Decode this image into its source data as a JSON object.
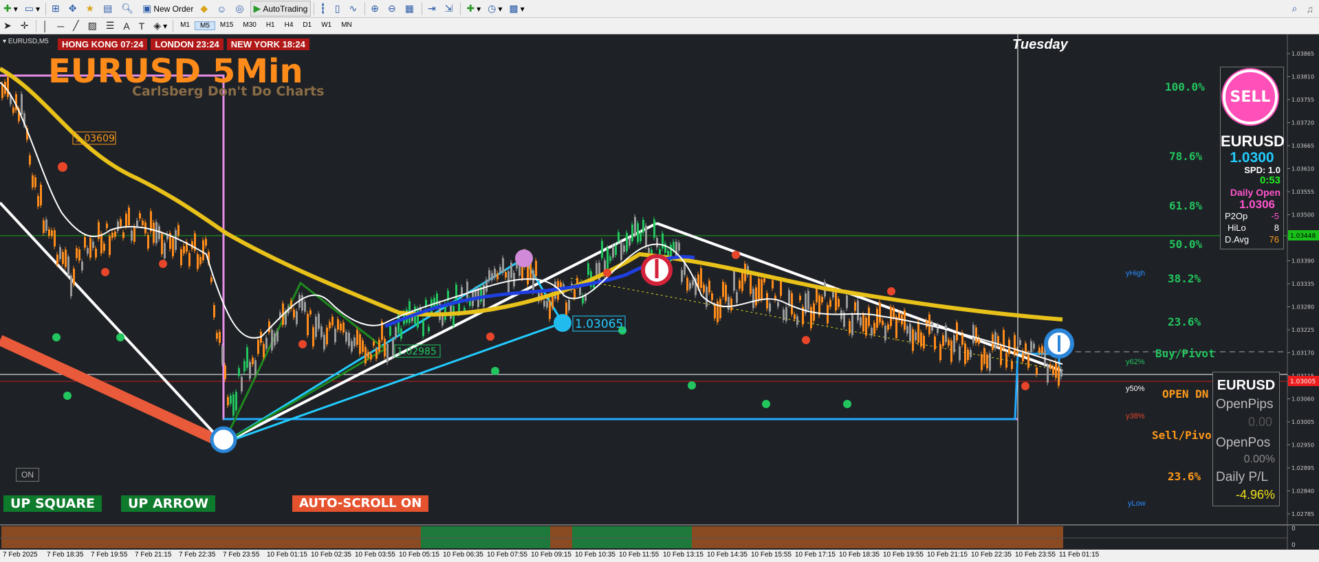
{
  "toolbar": {
    "new_order": "New Order",
    "auto_trading": "AutoTrading"
  },
  "timeframes": [
    "M1",
    "M5",
    "M15",
    "M30",
    "H1",
    "H4",
    "D1",
    "W1",
    "MN"
  ],
  "selected_timeframe": "M5",
  "chart": {
    "symbol_tab": "EURUSD,M5",
    "title": "EURUSD 5Min",
    "subtitle": "Carlsberg Don't Do Charts",
    "sessions": [
      {
        "label": "HONG KONG 07:24"
      },
      {
        "label": "LONDON  23:24"
      },
      {
        "label": "NEW YORK 18:24"
      }
    ],
    "day_label": "Tuesday",
    "price_axis": [
      "1.03865",
      "1.03810",
      "1.03755",
      "1.03720",
      "1.03665",
      "1.03610",
      "1.03555",
      "1.03500",
      "1.03448",
      "1.03390",
      "1.03335",
      "1.03280",
      "1.03225",
      "1.03170",
      "1.03115",
      "1.03060",
      "1.03005",
      "1.02950",
      "1.02895",
      "1.02840",
      "1.02785"
    ],
    "current_price_tag": "1.03448",
    "bid_price_tag": "1.03005",
    "time_axis": [
      "7 Feb 2025",
      "7 Feb 18:35",
      "7 Feb 19:55",
      "7 Feb 21:15",
      "7 Feb 22:35",
      "7 Feb 23:55",
      "10 Feb 01:15",
      "10 Feb 02:35",
      "10 Feb 03:55",
      "10 Feb 05:15",
      "10 Feb 06:35",
      "10 Feb 07:55",
      "10 Feb 09:15",
      "10 Feb 10:35",
      "10 Feb 11:55",
      "10 Feb 13:15",
      "10 Feb 14:35",
      "10 Feb 15:55",
      "10 Feb 17:15",
      "10 Feb 18:35",
      "10 Feb 19:55",
      "10 Feb 21:15",
      "10 Feb 22:35",
      "10 Feb 23:55",
      "11 Feb 01:15"
    ],
    "fib_levels": [
      {
        "label": "100.0%",
        "color": "#22c55e"
      },
      {
        "label": "78.6%",
        "color": "#22c55e"
      },
      {
        "label": "61.8%",
        "color": "#22c55e"
      },
      {
        "label": "50.0%",
        "color": "#22c55e"
      },
      {
        "label": "38.2%",
        "color": "#22c55e"
      },
      {
        "label": "23.6%",
        "color": "#22c55e"
      },
      {
        "label": "Buy/Pivot",
        "color": "#22c55e"
      },
      {
        "label": "OPEN DN",
        "color": "#ff9a1a"
      },
      {
        "label": "Sell/Pivo",
        "color": "#ff9a1a"
      },
      {
        "label": "23.6%",
        "color": "#ff9a1a"
      }
    ],
    "y_labels": {
      "high": "yHigh",
      "y62": "y62%",
      "y50": "y50%",
      "y38": "y38%",
      "low": "yLow"
    },
    "price_annotations": [
      "1.03609",
      "1.03065",
      "1.02985"
    ],
    "on_label": "ON"
  },
  "panel": {
    "sell_label": "SELL",
    "symbol": "EURUSD",
    "price": "1.0300",
    "spread": "SPD: 1.0",
    "timer": "0:53",
    "daily_open_label": "Daily Open",
    "daily_open": "1.0306",
    "p2op_label": "P2Op",
    "p2op": "-5",
    "hilo_label": "HiLo",
    "hilo": "8",
    "davg_label": "D.Avg",
    "davg": "76"
  },
  "pos_panel": {
    "symbol": "EURUSD",
    "open_pips_label": "OpenPips",
    "open_pips": "0.00",
    "open_pos_label": "OpenPos",
    "open_pos": "0.00%",
    "daily_pl_label": "Daily P/L",
    "daily_pl": "-4.96%"
  },
  "buttons": {
    "up_square": "UP SQUARE",
    "up_arrow": "UP ARROW",
    "auto_scroll": "AUTO-SCROLL ON"
  },
  "sub_window_axis": [
    "0",
    "0"
  ],
  "colors": {
    "background": "#1e2126",
    "bull_candle": "#22c55e",
    "bear_candle": "#ff8c1a",
    "neutral_candle": "#9a9a9a",
    "ma_yellow": "#e8c21a",
    "ma_blue": "#1f3fe0",
    "ma_white": "#ffffff",
    "sell_pink": "#ff4fb8",
    "cyan": "#22ccff",
    "session_red": "#b01818"
  }
}
